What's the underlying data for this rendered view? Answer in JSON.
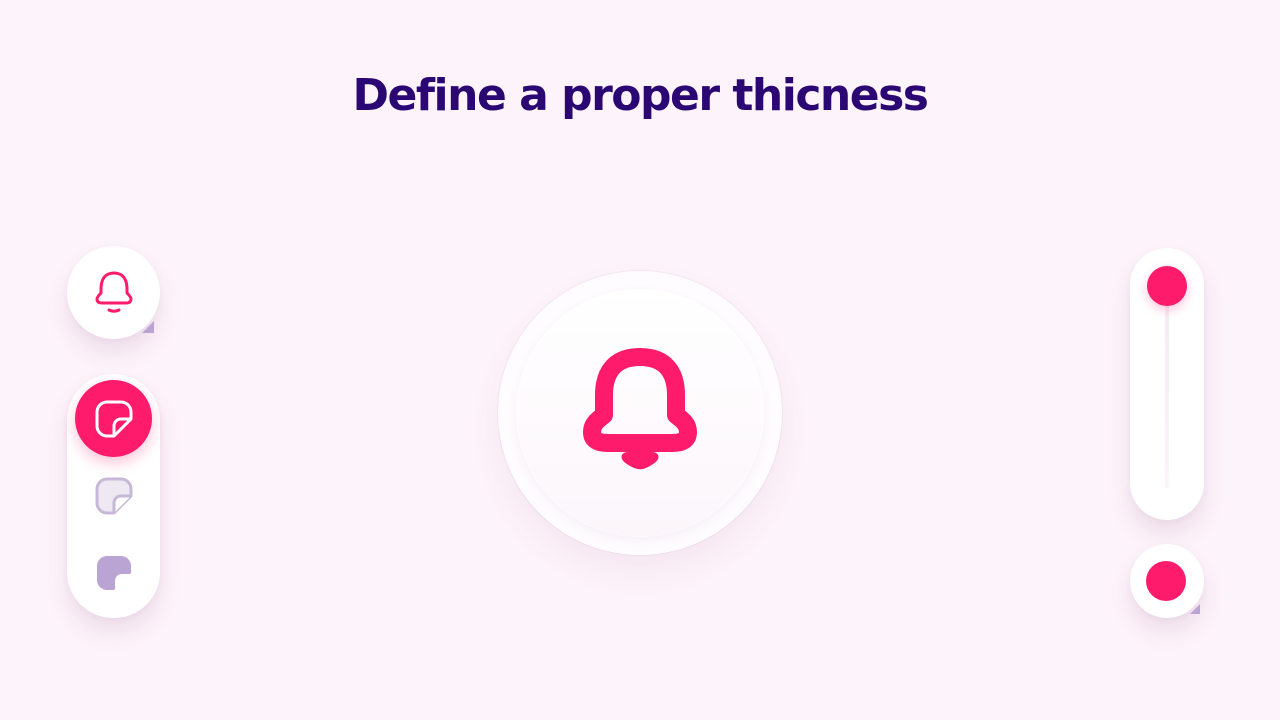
{
  "title": "Define a proper thicness",
  "colors": {
    "accent": "#ff1b6b",
    "title": "#2a0772",
    "background": "#fdf3fa",
    "muted_fill": "#eee8f3",
    "muted_stroke": "#c7b8d8",
    "solid_muted": "#b9a4d4"
  },
  "icons": {
    "preview": "bell-icon",
    "center": "bell-icon",
    "style_options": [
      "sticker-outline-icon",
      "sticker-light-icon",
      "sticker-solid-icon"
    ]
  },
  "style_panel": {
    "selected_index": 0
  },
  "thickness_slider": {
    "value_percent": 0
  }
}
